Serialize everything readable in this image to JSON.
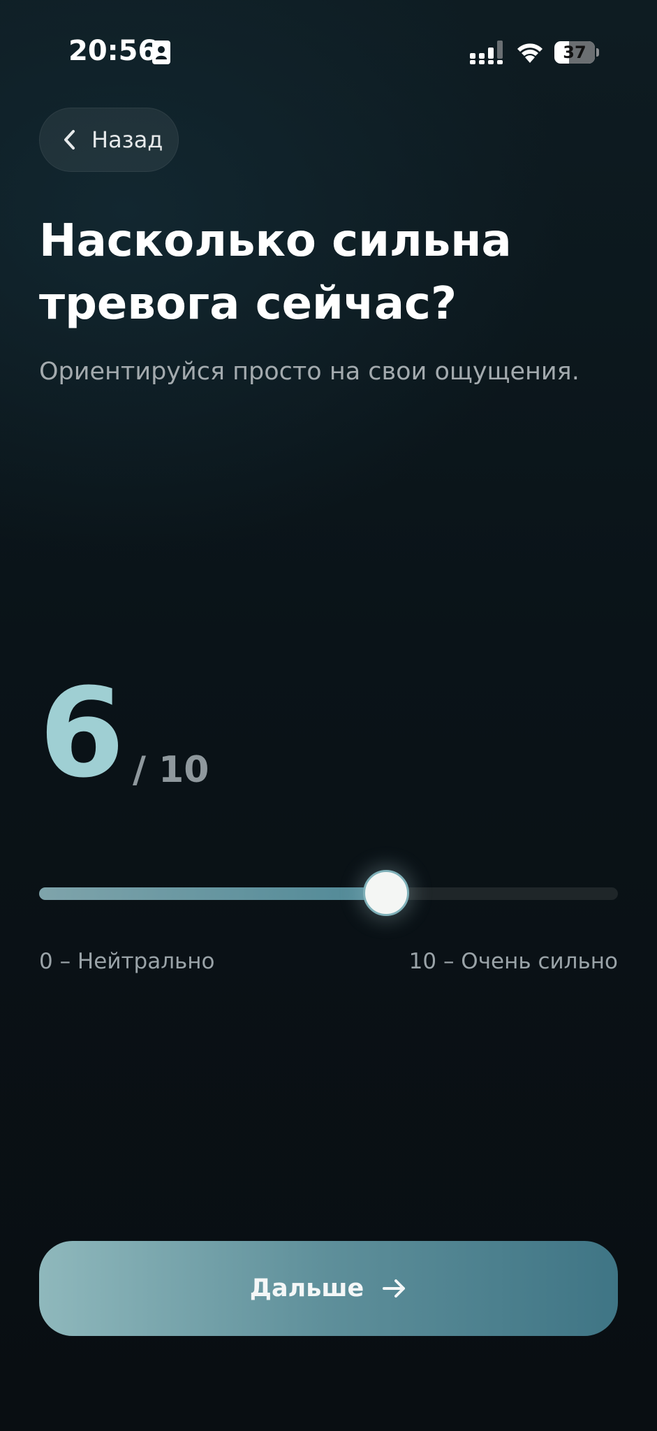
{
  "status_bar": {
    "time": "20:56",
    "battery_level": "37",
    "battery_fraction": 0.37
  },
  "header": {
    "back_label": "Назад"
  },
  "question": {
    "title_line1": "Насколько сильна",
    "title_line2": "тревога сейчас?",
    "subtitle": "Ориентируйся просто на свои ощущения."
  },
  "rating": {
    "value": 6,
    "max": 10,
    "value_text": "6",
    "max_text": "/ 10",
    "min_label": "0 – Нейтрально",
    "max_label": "10 – Очень сильно"
  },
  "footer": {
    "next_label": "Дальше"
  },
  "colors": {
    "accent": "#9fcfd3",
    "button_gradient_start": "#8fb8bc",
    "button_gradient_end": "#3f7585",
    "background": "#0a1318"
  },
  "icons": {
    "back": "chevron-left-icon",
    "next": "arrow-right-icon",
    "status": [
      "contact-card-icon",
      "signal-icon",
      "wifi-icon",
      "battery-icon"
    ]
  }
}
